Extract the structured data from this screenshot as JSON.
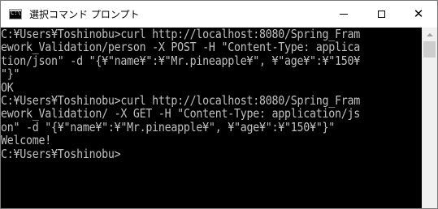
{
  "window": {
    "title": "選択コマンド プロンプト",
    "app_icon_label": "C:\\",
    "app_icon": "command-prompt-icon",
    "controls": {
      "minimize_icon": "minimize-icon",
      "maximize_icon": "maximize-icon",
      "close_icon": "close-icon",
      "close_glyph": "✕"
    }
  },
  "console": {
    "lines": [
      "C:¥Users¥Toshinobu>curl http://localhost:8080/Spring_Fram",
      "ework_Validation/person -X POST -H \"Content-Type: applica",
      "tion/json\" -d \"{¥\"name¥\":¥\"Mr.pineapple¥\", ¥\"age¥\":¥\"150¥",
      "\"}\"",
      "OK",
      "C:¥Users¥Toshinobu>curl http://localhost:8080/Spring_Fram",
      "ework_Validation/ -X GET -H \"Content-Type: application/js",
      "on\" -d \"{¥\"name¥\":¥\"Mr.pineapple¥\", ¥\"age¥\":¥\"150¥\"}\"",
      "Welcome!",
      "C:¥Users¥Toshinobu>"
    ]
  },
  "colors": {
    "console_background": "#000000",
    "console_text": "#c0c0c0",
    "titlebar_background": "#ffffff"
  }
}
